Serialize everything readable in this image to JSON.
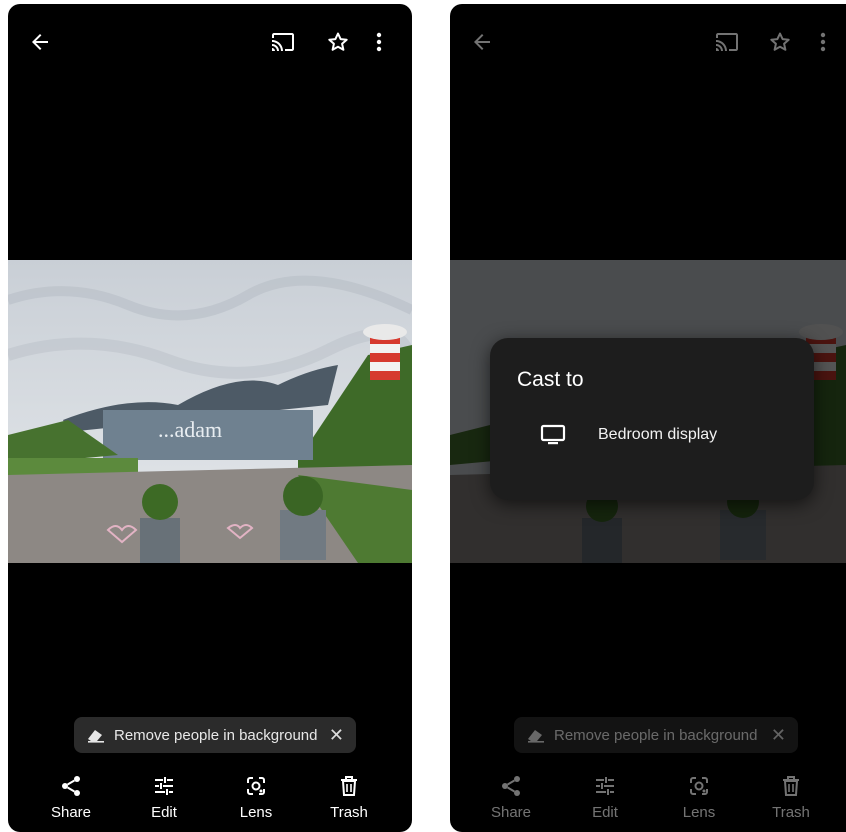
{
  "left_screen": {
    "top_icons": [
      "back-arrow-icon",
      "cast-icon",
      "star-icon",
      "more-vert-icon"
    ],
    "suggestion_chip": {
      "icon": "eraser-icon",
      "label": "Remove people in background",
      "close": "✕"
    },
    "actions": [
      {
        "label": "Share",
        "icon": "share-icon"
      },
      {
        "label": "Edit",
        "icon": "edit-sliders-icon"
      },
      {
        "label": "Lens",
        "icon": "lens-icon"
      },
      {
        "label": "Trash",
        "icon": "trash-icon"
      }
    ]
  },
  "right_screen": {
    "top_icons": [
      "back-arrow-icon",
      "cast-icon",
      "star-icon",
      "more-vert-icon"
    ],
    "cast_dialog": {
      "title": "Cast to",
      "device": {
        "icon": "tv-icon",
        "label": "Bedroom display"
      }
    },
    "suggestion_chip": {
      "icon": "eraser-icon",
      "label": "Remove people in background",
      "close": "✕"
    },
    "actions": [
      {
        "label": "Share",
        "icon": "share-icon"
      },
      {
        "label": "Edit",
        "icon": "edit-sliders-icon"
      },
      {
        "label": "Lens",
        "icon": "lens-icon"
      },
      {
        "label": "Trash",
        "icon": "trash-icon"
      }
    ]
  },
  "photo": {
    "sign_text": "...adam",
    "colors": {
      "sky": "#d8dde3",
      "grass": "#3f6b2a",
      "pavement": "#8a8582",
      "building": "#5a6a78"
    }
  }
}
